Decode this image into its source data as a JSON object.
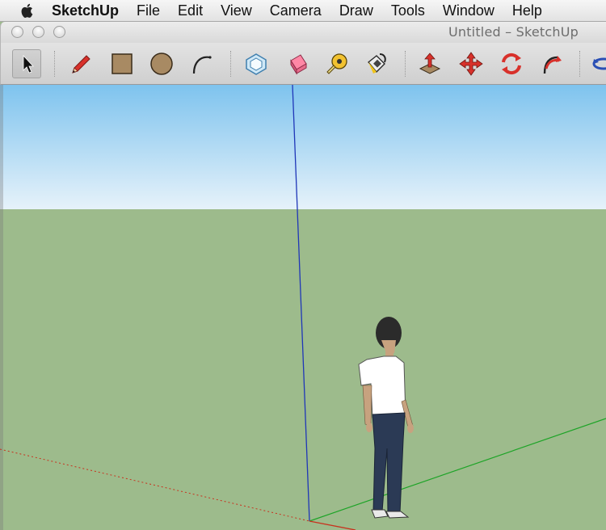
{
  "menubar": {
    "app_name": "SketchUp",
    "items": [
      "File",
      "Edit",
      "View",
      "Camera",
      "Draw",
      "Tools",
      "Window",
      "Help"
    ]
  },
  "window": {
    "title": "Untitled – SketchUp"
  },
  "toolbar": {
    "tools": [
      {
        "name": "select-icon"
      },
      {
        "name": "pencil-icon"
      },
      {
        "name": "rectangle-icon"
      },
      {
        "name": "circle-icon"
      },
      {
        "name": "arc-icon"
      },
      {
        "name": "make-component-icon"
      },
      {
        "name": "eraser-icon"
      },
      {
        "name": "tape-measure-icon"
      },
      {
        "name": "paint-bucket-icon"
      },
      {
        "name": "push-pull-icon"
      },
      {
        "name": "move-icon"
      },
      {
        "name": "rotate-icon"
      },
      {
        "name": "follow-me-icon"
      },
      {
        "name": "orbit-icon"
      }
    ]
  },
  "colors": {
    "sky_top": "#7ec3ee",
    "sky_bottom": "#e6f2fa",
    "ground": "#9dbb8c",
    "axis_blue": "#1f36b8",
    "axis_green": "#1da427",
    "axis_red": "#c8321e"
  }
}
